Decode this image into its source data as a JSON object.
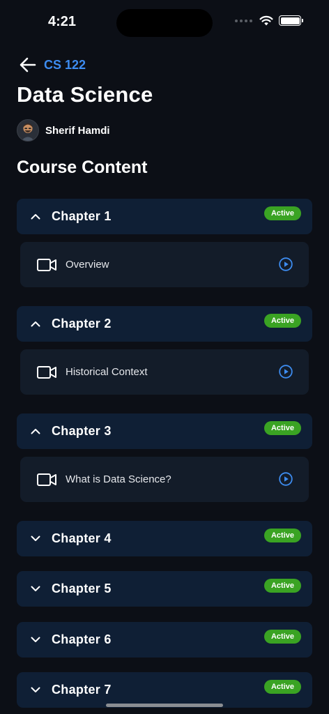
{
  "status_bar": {
    "time": "4:21"
  },
  "header": {
    "back_label": "CS 122",
    "course_title": "Data Science",
    "instructor_name": "Sherif Hamdi"
  },
  "section_title": "Course Content",
  "chapters": [
    {
      "title": "Chapter 1",
      "badge": "Active",
      "expanded": true,
      "lessons": [
        {
          "title": "Overview"
        }
      ]
    },
    {
      "title": "Chapter 2",
      "badge": "Active",
      "expanded": true,
      "lessons": [
        {
          "title": "Historical Context"
        }
      ]
    },
    {
      "title": "Chapter 3",
      "badge": "Active",
      "expanded": true,
      "lessons": [
        {
          "title": "What is Data Science?"
        }
      ]
    },
    {
      "title": "Chapter 4",
      "badge": "Active",
      "expanded": false
    },
    {
      "title": "Chapter 5",
      "badge": "Active",
      "expanded": false
    },
    {
      "title": "Chapter 6",
      "badge": "Active",
      "expanded": false
    },
    {
      "title": "Chapter 7",
      "badge": "Active",
      "expanded": false
    }
  ],
  "colors": {
    "background": "#0c0f16",
    "chapter_bg": "#0f1f35",
    "lesson_bg": "#131c29",
    "accent": "#3d8cf0",
    "badge": "#3aa323"
  },
  "icons": {
    "back": "arrow-left-icon",
    "chevron_up": "chevron-up-icon",
    "chevron_down": "chevron-down-icon",
    "lesson": "video-camera-icon",
    "play": "play-circle-icon"
  }
}
